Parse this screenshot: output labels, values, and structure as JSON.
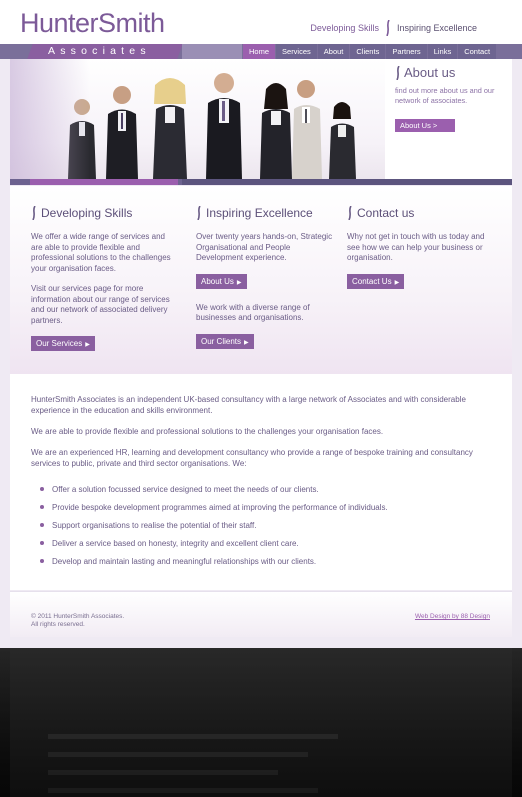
{
  "brand": {
    "logo_text": "HunterSmith",
    "associates_text": "Associates",
    "tagline_1": "Developing Skills",
    "tagline_2": "Inspiring Excellence"
  },
  "nav": {
    "items": [
      "Home",
      "Services",
      "About",
      "Clients",
      "Partners",
      "Links",
      "Contact"
    ],
    "active": "Home"
  },
  "hero": {
    "about_title": "About us",
    "about_sub": "find out more about us and our network of associates.",
    "about_button": "About Us >"
  },
  "columns": [
    {
      "title": "Developing Skills",
      "p1": "We offer a wide range of services and are able to provide flexible and professional solutions to the challenges your organisation faces.",
      "p2": "Visit our services page for more information about our range of services and our network of associated delivery partners.",
      "button": "Our Services"
    },
    {
      "title": "Inspiring Excellence",
      "p1": "Over twenty years hands-on, Strategic Organisational and People Development experience.",
      "button1": "About Us",
      "p2": "We work with a diverse range of businesses and organisations.",
      "button2": "Our Clients"
    },
    {
      "title": "Contact us",
      "p1": "Why not get in touch with us today and see how we can help your business or organisation.",
      "button": "Contact Us"
    }
  ],
  "main": {
    "p1": "HunterSmith Associates is an independent UK-based consultancy with a large network of Associates and with considerable experience in the education and skills environment.",
    "p2": "We are able to provide flexible and professional solutions to the challenges your organisation faces.",
    "p3": "We are an experienced HR, learning and development consultancy who provide a range of bespoke training and consultancy services to public, private and third sector organisations. We:",
    "bullets": [
      "Offer a solution focussed service designed to meet the needs of our clients.",
      "Provide bespoke development programmes aimed at improving the performance of individuals.",
      "Support organisations to realise the potential of their staff.",
      "Deliver a service based on honesty, integrity and excellent client care.",
      "Develop and maintain lasting and meaningful relationships with our clients."
    ]
  },
  "footer": {
    "copyright_1": "© 2011 HunterSmith Associates.",
    "copyright_2": "All rights reserved.",
    "credit": "Web Design by 88 Design"
  },
  "colors": {
    "accent_purple": "#9b5fae",
    "nav_blue": "#6e6591",
    "text": "#6a5c86"
  }
}
